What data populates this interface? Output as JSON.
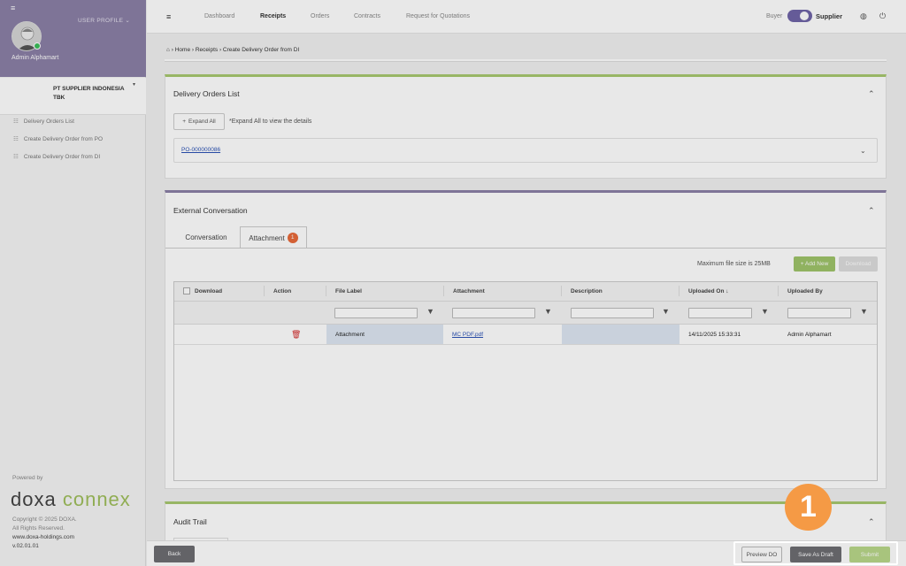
{
  "sidebar": {
    "user_profile": "USER PROFILE",
    "user_name": "Admin Alphamart",
    "company_name": "PT SUPPLIER INDONESIA TBK",
    "items": [
      {
        "label": "Delivery Orders List"
      },
      {
        "label": "Create Delivery Order from PO"
      },
      {
        "label": "Create Delivery Order from DI"
      }
    ],
    "powered_by": "Powered by",
    "logo_part1": "doxa",
    "logo_part2": "connex",
    "copyright_line1": "Copyright © 2025 DOXA.",
    "copyright_line2": "All Rights Reserved.",
    "website": "www.doxa-holdings.com",
    "version": "v.02.01.01"
  },
  "topbar": {
    "nav": [
      "Dashboard",
      "Receipts",
      "Orders",
      "Contracts",
      "Request for Quotations"
    ],
    "buyer_label": "Buyer",
    "supplier_label": "Supplier"
  },
  "breadcrumb": {
    "items": [
      "Home",
      "Receipts",
      "Create Delivery Order from DI"
    ]
  },
  "delivery_orders": {
    "title": "Delivery Orders List",
    "expand_all": "Expand All",
    "expand_note": "*Expand All to view the details",
    "po_number": "PO-000000086"
  },
  "conversation": {
    "title": "External Conversation",
    "tabs": [
      "Conversation",
      "Attachment"
    ],
    "attachment_count": "1",
    "max_file_size": "Maximum file size is 25MB",
    "add_new": "+ Add New",
    "download": "Download",
    "columns": [
      "Download",
      "Action",
      "File Label",
      "Attachment",
      "Description",
      "Uploaded On",
      "Uploaded By"
    ],
    "sort_indicator": "↓",
    "rows": [
      {
        "file_label": "Attachment",
        "attachment": "MC PDF.pdf",
        "description": "",
        "uploaded_on": "14/11/2025 15:33:31",
        "uploaded_by": "Admin Alphamart"
      }
    ]
  },
  "audit": {
    "title": "Audit Trail"
  },
  "footer": {
    "back": "Back",
    "preview": "Preview DO",
    "save_draft": "Save As Draft",
    "submit": "Submit"
  },
  "overlay": {
    "step_number": "1"
  },
  "colors": {
    "profile_bg": "#8b80a6",
    "accent_green": "#9fc46a",
    "accent_purple": "#8b80a6",
    "step_badge": "#f59a45",
    "link": "#2b52b5"
  }
}
